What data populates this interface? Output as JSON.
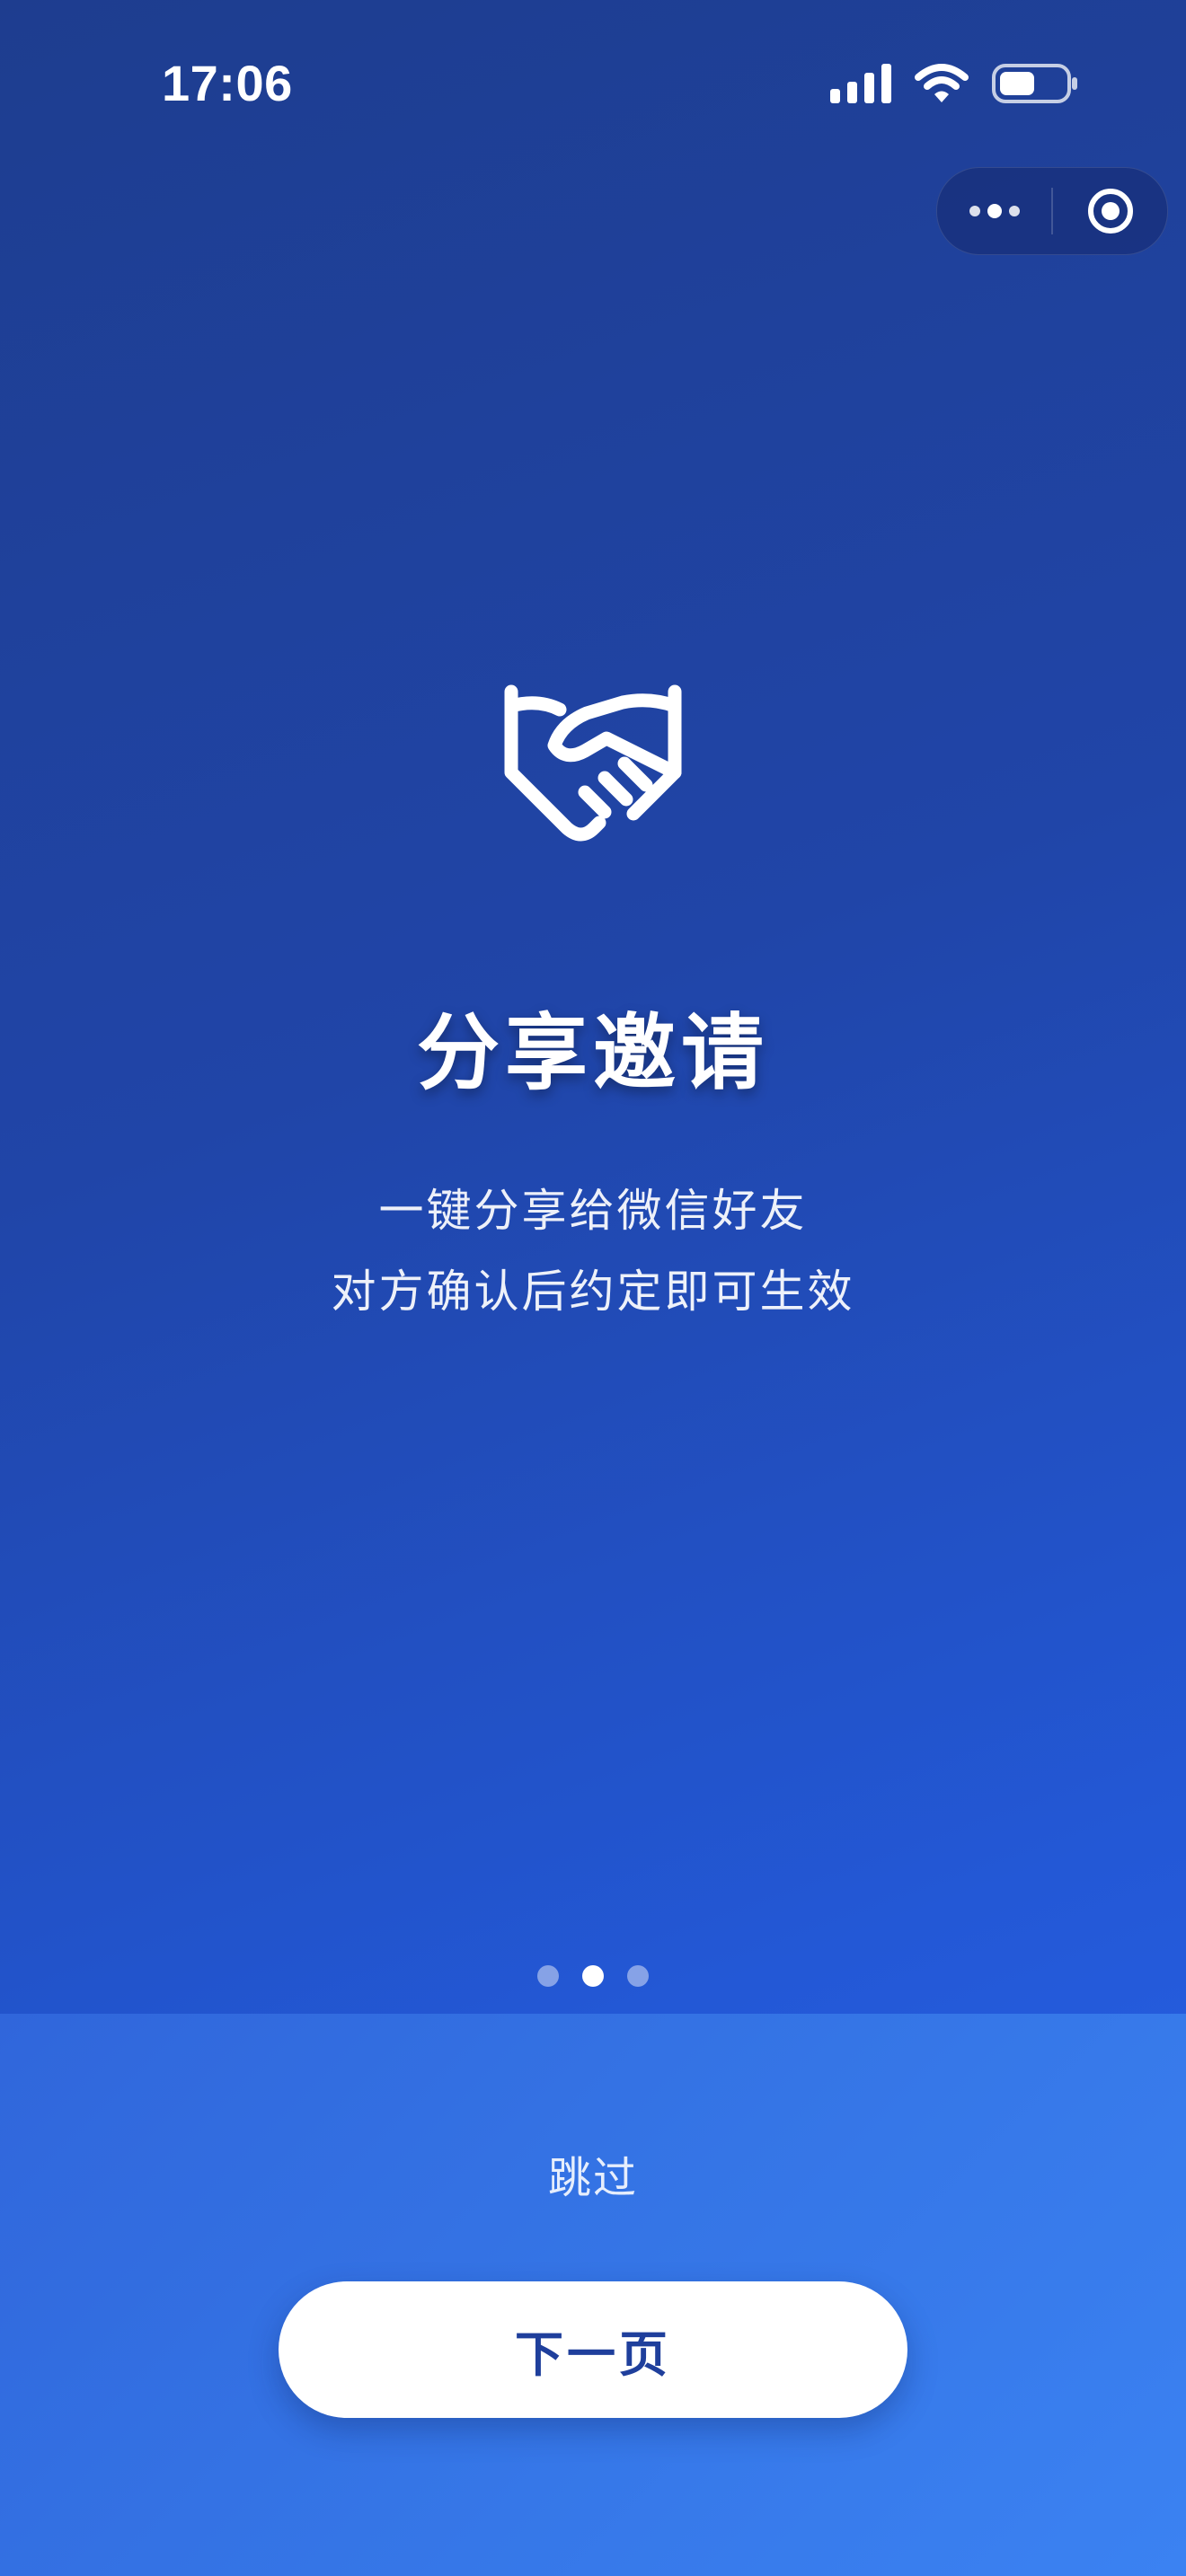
{
  "status_bar": {
    "time": "17:06",
    "icons": [
      "signal-icon",
      "wifi-icon",
      "battery-icon"
    ]
  },
  "capsule": {
    "icons": [
      "more-dots-icon",
      "close-target-icon"
    ]
  },
  "hero": {
    "icon": "handshake-icon",
    "title": "分享邀请",
    "subtitle_lines": [
      "一键分享给微信好友",
      "对方确认后约定即可生效"
    ]
  },
  "pager": {
    "total": 3,
    "active_index": 1
  },
  "actions": {
    "skip_label": "跳过",
    "next_label": "下一页"
  },
  "colors": {
    "background_top": "#1e3d8f",
    "background_bottom": "#2a64ec",
    "panel": "#3575e6",
    "button_bg": "#ffffff",
    "button_text": "#1f3f9c"
  }
}
